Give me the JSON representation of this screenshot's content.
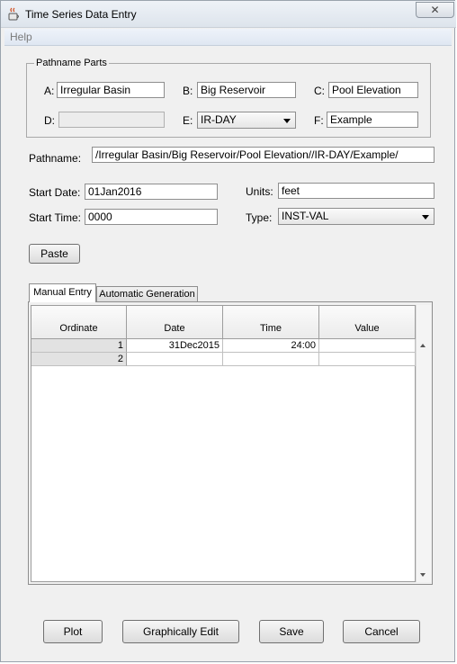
{
  "window": {
    "title": "Time Series Data Entry",
    "close_glyph": "✕"
  },
  "menu": {
    "help": "Help"
  },
  "pathname_parts": {
    "legend": "Pathname Parts",
    "a": {
      "label": "A:",
      "value": "Irregular Basin"
    },
    "b": {
      "label": "B:",
      "value": "Big Reservoir"
    },
    "c": {
      "label": "C:",
      "value": "Pool Elevation"
    },
    "d": {
      "label": "D:",
      "value": ""
    },
    "e": {
      "label": "E:",
      "value": "IR-DAY"
    },
    "f": {
      "label": "F:",
      "value": "Example"
    }
  },
  "pathname": {
    "label": "Pathname:",
    "value": "/Irregular Basin/Big Reservoir/Pool Elevation//IR-DAY/Example/"
  },
  "start_date": {
    "label": "Start Date:",
    "value": "01Jan2016"
  },
  "start_time": {
    "label": "Start Time:",
    "value": "0000"
  },
  "units": {
    "label": "Units:",
    "value": "feet"
  },
  "type": {
    "label": "Type:",
    "value": "INST-VAL"
  },
  "paste_label": "Paste",
  "tabs": [
    {
      "label": "Manual Entry",
      "active": true
    },
    {
      "label": "Automatic Generation",
      "active": false
    }
  ],
  "table": {
    "columns": [
      "Ordinate",
      "Date",
      "Time",
      "Value"
    ],
    "rows": [
      {
        "ordinate": "1",
        "date": "31Dec2015",
        "time": "24:00",
        "value": ""
      },
      {
        "ordinate": "2",
        "date": "",
        "time": "",
        "value": ""
      }
    ]
  },
  "buttons": {
    "plot": "Plot",
    "graphically_edit": "Graphically Edit",
    "save": "Save",
    "cancel": "Cancel"
  },
  "icons": {
    "app": "java-cup-icon",
    "close": "close-icon",
    "dropdown": "chevron-down-icon"
  }
}
